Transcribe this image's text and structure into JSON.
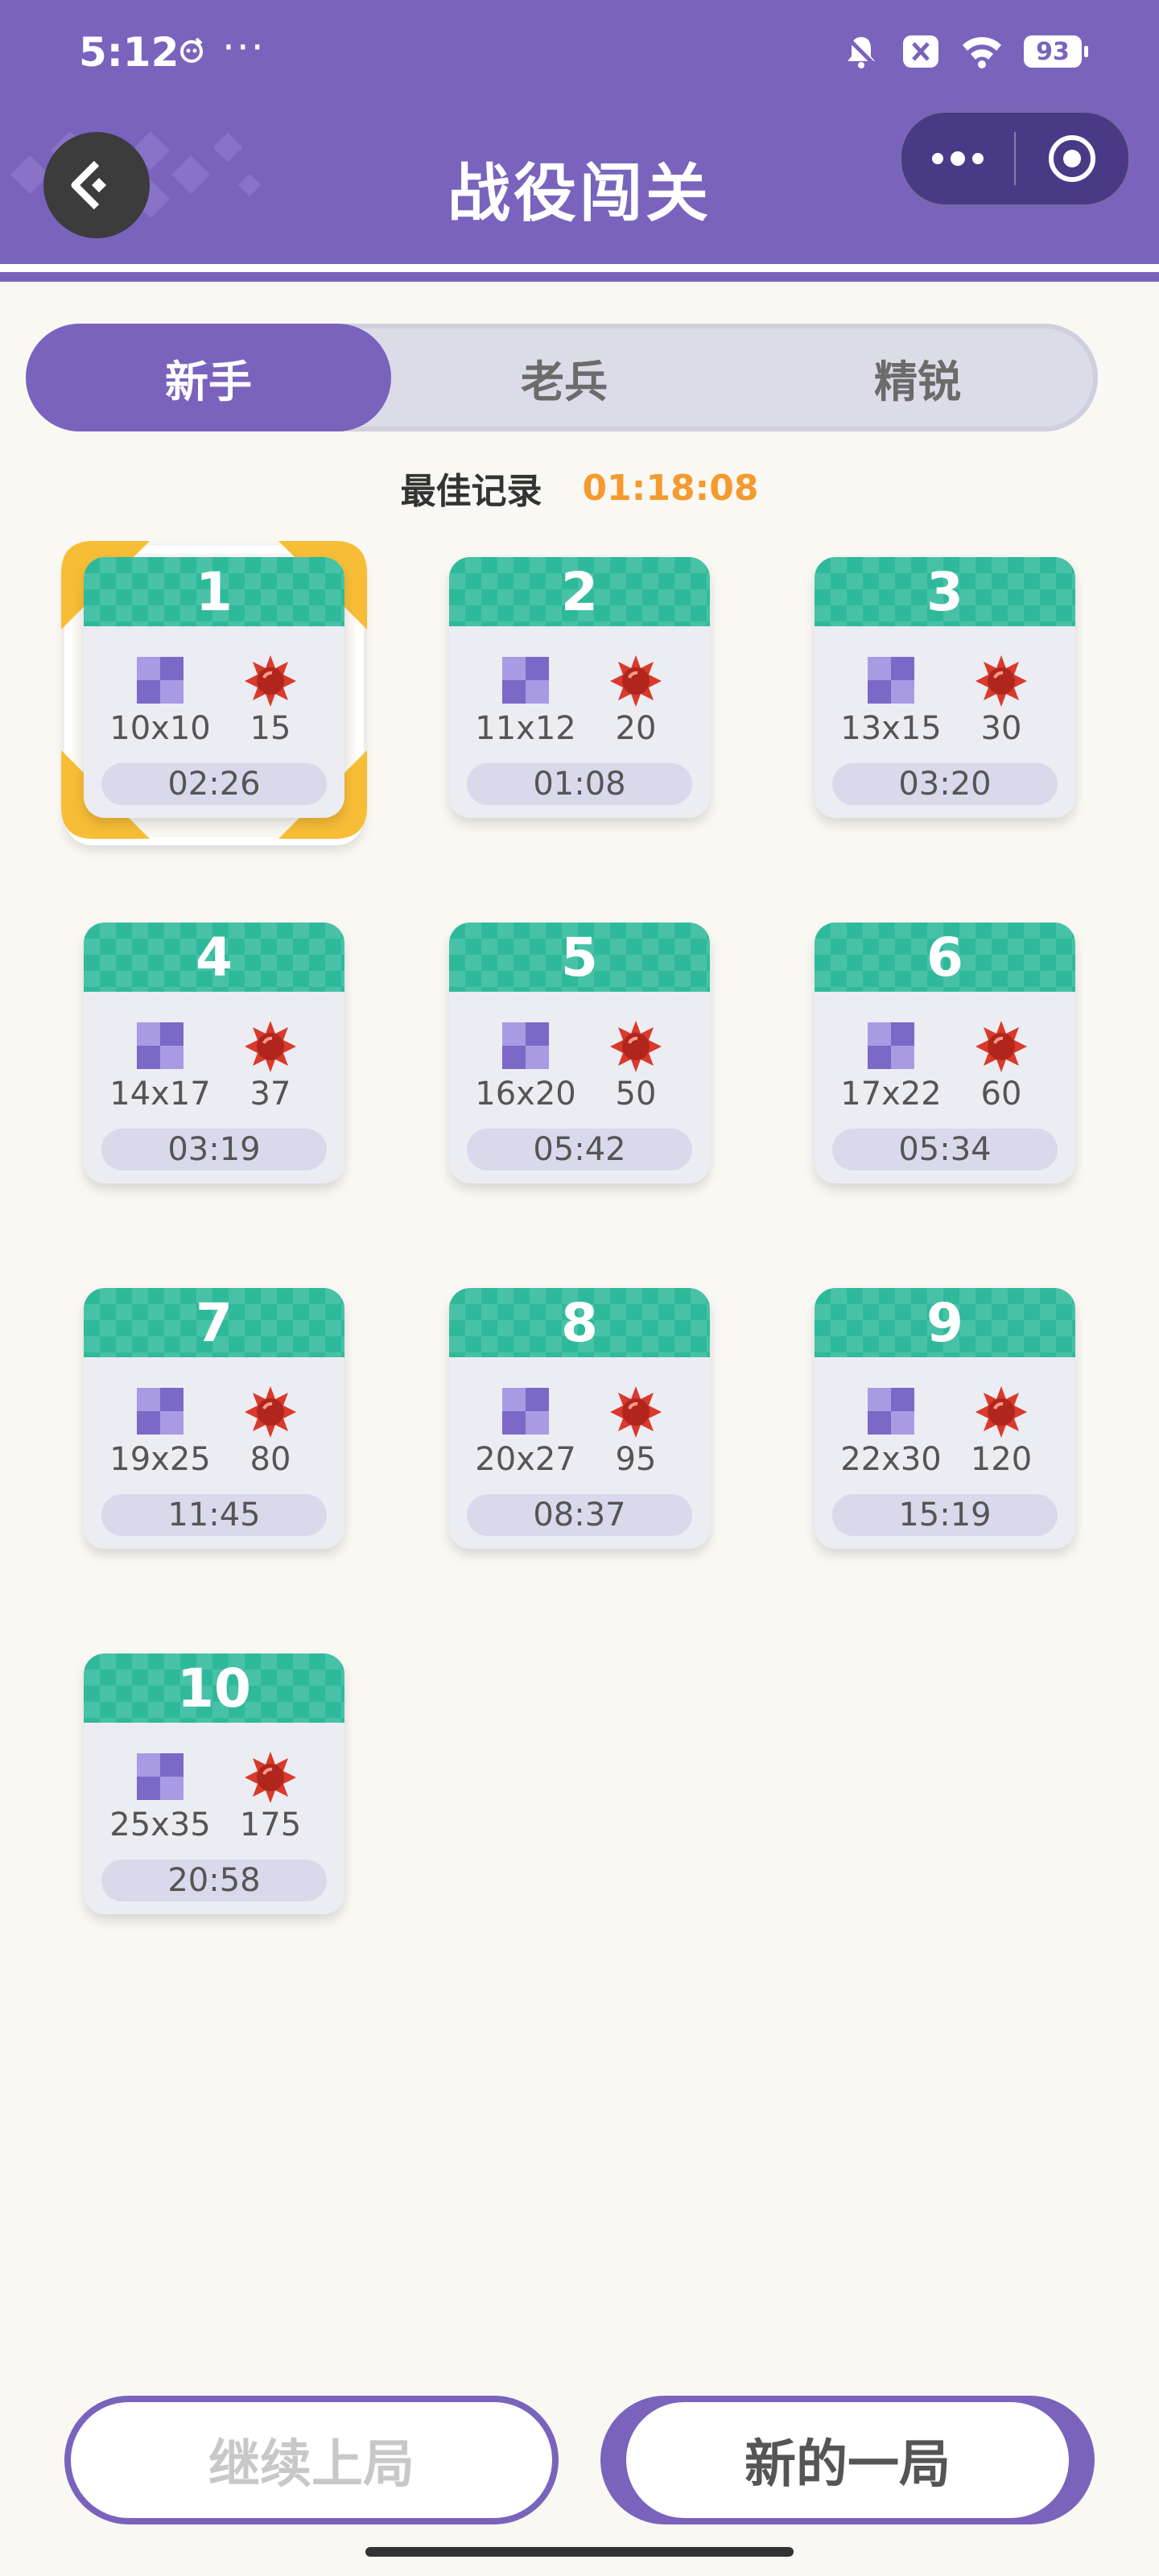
{
  "status_bar": {
    "time": "5:12",
    "dots": "···",
    "battery": "93"
  },
  "header": {
    "title": "战役闯关"
  },
  "tabs": [
    {
      "label": "新手",
      "active": true
    },
    {
      "label": "老兵",
      "active": false
    },
    {
      "label": "精锐",
      "active": false
    }
  ],
  "best_record": {
    "label": "最佳记录",
    "value": "01:18:08"
  },
  "levels": [
    {
      "num": "1",
      "size": "10x10",
      "mines": "15",
      "time": "02:26",
      "selected": true
    },
    {
      "num": "2",
      "size": "11x12",
      "mines": "20",
      "time": "01:08"
    },
    {
      "num": "3",
      "size": "13x15",
      "mines": "30",
      "time": "03:20"
    },
    {
      "num": "4",
      "size": "14x17",
      "mines": "37",
      "time": "03:19"
    },
    {
      "num": "5",
      "size": "16x20",
      "mines": "50",
      "time": "05:42"
    },
    {
      "num": "6",
      "size": "17x22",
      "mines": "60",
      "time": "05:34"
    },
    {
      "num": "7",
      "size": "19x25",
      "mines": "80",
      "time": "11:45"
    },
    {
      "num": "8",
      "size": "20x27",
      "mines": "95",
      "time": "08:37"
    },
    {
      "num": "9",
      "size": "22x30",
      "mines": "120",
      "time": "15:19"
    },
    {
      "num": "10",
      "size": "25x35",
      "mines": "175",
      "time": "20:58"
    }
  ],
  "buttons": {
    "continue_label": "继续上局",
    "new_label": "新的一局"
  },
  "colors": {
    "purple": "#7a63bd",
    "teal": "#2fb99b",
    "orange": "#f59a2e",
    "selection_gold": "#f7bd36"
  },
  "icons": [
    "back-icon",
    "more-icon",
    "record-icon",
    "grid-size-icon",
    "mine-icon",
    "bell-off-icon",
    "wifi-icon"
  ]
}
